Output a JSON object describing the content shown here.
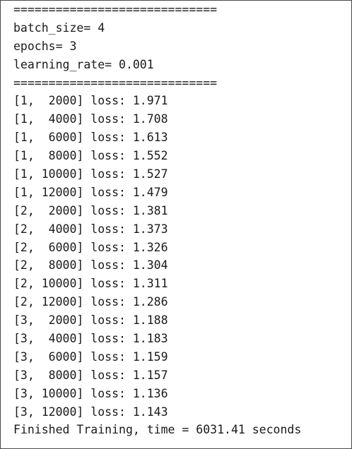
{
  "console": {
    "lines": [
      "=============================",
      "batch_size= 4",
      "epochs= 3",
      "learning_rate= 0.001",
      "=============================",
      "[1,  2000] loss: 1.971",
      "[1,  4000] loss: 1.708",
      "[1,  6000] loss: 1.613",
      "[1,  8000] loss: 1.552",
      "[1, 10000] loss: 1.527",
      "[1, 12000] loss: 1.479",
      "[2,  2000] loss: 1.381",
      "[2,  4000] loss: 1.373",
      "[2,  6000] loss: 1.326",
      "[2,  8000] loss: 1.304",
      "[2, 10000] loss: 1.311",
      "[2, 12000] loss: 1.286",
      "[3,  2000] loss: 1.188",
      "[3,  4000] loss: 1.183",
      "[3,  6000] loss: 1.159",
      "[3,  8000] loss: 1.157",
      "[3, 10000] loss: 1.136",
      "[3, 12000] loss: 1.143",
      "Finished Training, time = 6031.41 seconds"
    ]
  }
}
